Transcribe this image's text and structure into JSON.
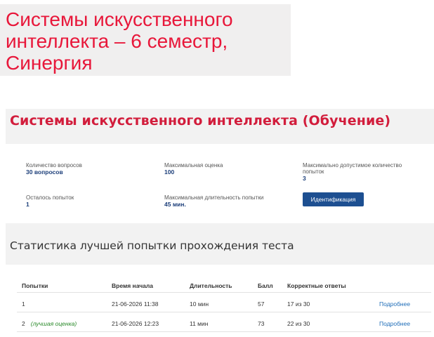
{
  "banner": {
    "title": "Системы искусственного интеллекта – 6 семестр, Синергия",
    "color": "#e8173a"
  },
  "course": {
    "title": "Системы искусственного интеллекта (Обучение)",
    "title_color": "#d21d3c"
  },
  "info": {
    "questions_label": "Количество вопросов",
    "questions_value": "30 вопросов",
    "max_score_label": "Максимальная оценка",
    "max_score_value": "100",
    "max_attempts_label": "Максимально допустимое количество попыток",
    "max_attempts_value": "3",
    "remaining_label": "Осталось попыток",
    "remaining_value": "1",
    "duration_label": "Максимальная длительность попытки",
    "duration_value": "45 мин.",
    "ident_button": "Идентификация",
    "button_color": "#1d4f91"
  },
  "stats": {
    "title": "Статистика лучшей попытки прохождения теста",
    "headers": [
      "Попытки",
      "Время начала",
      "Длительность",
      "Балл",
      "Корректные ответы"
    ],
    "rows": [
      {
        "attempt": "1",
        "note": "",
        "start": "21-06-2026 11:38",
        "duration": "10 мин",
        "score": "57",
        "correct": "17 из 30",
        "link": "Подробнее"
      },
      {
        "attempt": "2",
        "note": "(лучшая оценка)",
        "start": "21-06-2026 12:23",
        "duration": "11 мин",
        "score": "73",
        "correct": "22 из 30",
        "link": "Подробнее"
      }
    ]
  }
}
